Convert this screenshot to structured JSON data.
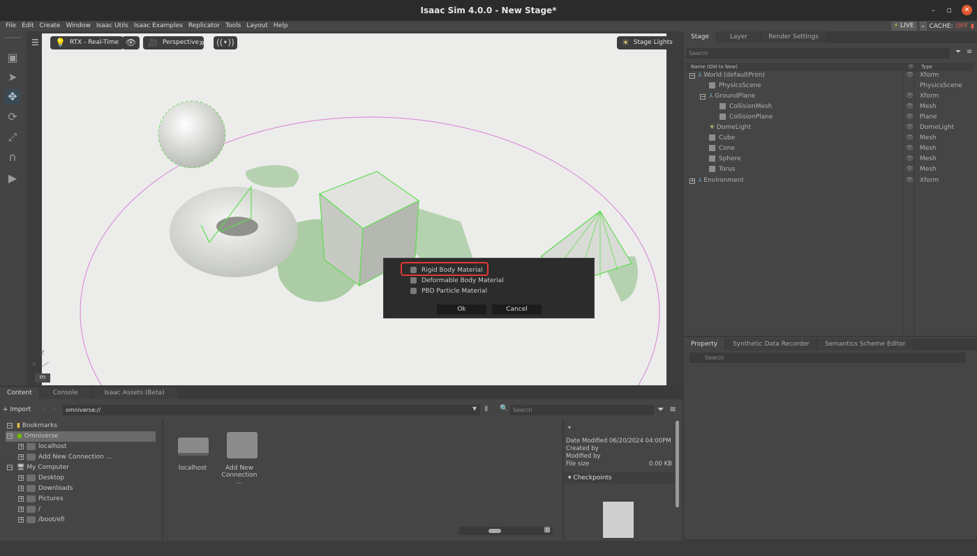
{
  "window": {
    "title": "Isaac Sim 4.0.0 - New Stage*",
    "controls": [
      "–",
      "▫",
      "✕"
    ]
  },
  "menu": {
    "items": [
      "File",
      "Edit",
      "Create",
      "Window",
      "Isaac Utils",
      "Isaac Examples",
      "Replicator",
      "Tools",
      "Layout",
      "Help"
    ],
    "live_label": "LIVE",
    "cache_label": "CACHE:",
    "cache_state": "OFF"
  },
  "viewport": {
    "renderer": "RTX - Real-Time",
    "camera": "Perspective",
    "lights": "Stage Lights",
    "unit": "m",
    "axis_x": "X",
    "axis_z": "Z"
  },
  "dialog": {
    "options": [
      "Rigid Body Material",
      "Deformable Body Material",
      "PBD Particle Material"
    ],
    "ok": "Ok",
    "cancel": "Cancel"
  },
  "stage": {
    "tabs": [
      "Stage",
      "Layer",
      "Render Settings"
    ],
    "search_placeholder": "Search",
    "col_name": "Name (Old to New)",
    "col_type": "Type",
    "rows": [
      {
        "name": "World (defaultPrim)",
        "type": "Xform"
      },
      {
        "name": "PhysicsScene",
        "type": "PhysicsScene"
      },
      {
        "name": "GroundPlane",
        "type": "Xform"
      },
      {
        "name": "CollisionMesh",
        "type": "Mesh"
      },
      {
        "name": "CollisionPlane",
        "type": "Plane"
      },
      {
        "name": "DomeLight",
        "type": "DomeLight"
      },
      {
        "name": "Cube",
        "type": "Mesh"
      },
      {
        "name": "Cone",
        "type": "Mesh"
      },
      {
        "name": "Sphere",
        "type": "Mesh"
      },
      {
        "name": "Torus",
        "type": "Mesh"
      },
      {
        "name": "Environment",
        "type": "Xform"
      }
    ]
  },
  "property": {
    "tabs": [
      "Property",
      "Synthetic Data Recorder",
      "Semantics Scheme Editor"
    ],
    "search_placeholder": "Search"
  },
  "content": {
    "tabs": [
      "Content",
      "Console",
      "Isaac Assets (Beta)"
    ],
    "import_label": "Import",
    "path": "omniverse://",
    "search_placeholder": "Search",
    "tree": [
      {
        "label": "Bookmarks"
      },
      {
        "label": "Omniverse"
      },
      {
        "label": "localhost"
      },
      {
        "label": "Add New Connection ..."
      },
      {
        "label": "My Computer"
      },
      {
        "label": "Desktop"
      },
      {
        "label": "Downloads"
      },
      {
        "label": "Pictures"
      },
      {
        "label": "/"
      },
      {
        "label": "/boot/efi"
      }
    ],
    "grid": [
      {
        "label": "localhost"
      },
      {
        "label": "Add New Connection ..."
      }
    ],
    "details": {
      "date_modified": "Date Modified 06/20/2024 04:00PM",
      "created_by": "Created by",
      "modified_by": "Modified by",
      "file_size_label": "File size",
      "file_size": "0.00 KB",
      "checkpoints": "Checkpoints"
    }
  }
}
